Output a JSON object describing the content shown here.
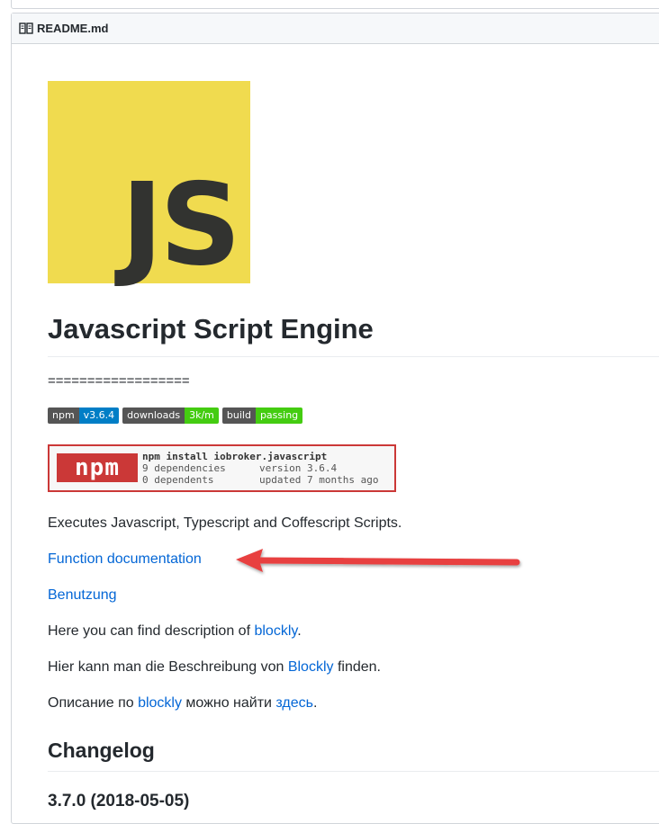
{
  "readme": {
    "title": "README.md",
    "logo_text": "JS",
    "heading": "Javascript Script Engine",
    "equals": "==================",
    "badges": [
      {
        "label": "npm",
        "value": "v3.6.4",
        "color": "#007ec6"
      },
      {
        "label": "downloads",
        "value": "3k/m",
        "color": "#4c1"
      },
      {
        "label": "build",
        "value": "passing",
        "color": "#4c1"
      }
    ],
    "npm_card": {
      "logo": "npm",
      "command": "npm install iobroker.javascript",
      "dependencies": "9 dependencies",
      "version": "version 3.6.4",
      "dependents": "0 dependents",
      "updated": "updated 7 months ago"
    },
    "description": "Executes Javascript, Typescript and Coffescript Scripts.",
    "function_doc_link": "Function documentation",
    "benutzung_link": "Benutzung",
    "blockly_en": {
      "before": "Here you can find description of ",
      "link": "blockly",
      "after": "."
    },
    "blockly_de": {
      "before": "Hier kann man die Beschreibung von ",
      "link": "Blockly",
      "after": " finden."
    },
    "blockly_ru": {
      "before": "Описание по ",
      "link": "blockly",
      "middle": " можно найти ",
      "link2": "здесь",
      "after": "."
    },
    "changelog_heading": "Changelog",
    "version_heading": "3.7.0 (2018-05-05)"
  },
  "colors": {
    "link": "#0366d6",
    "annotation_arrow": "#e8403f",
    "js_yellow": "#f0db4f"
  }
}
